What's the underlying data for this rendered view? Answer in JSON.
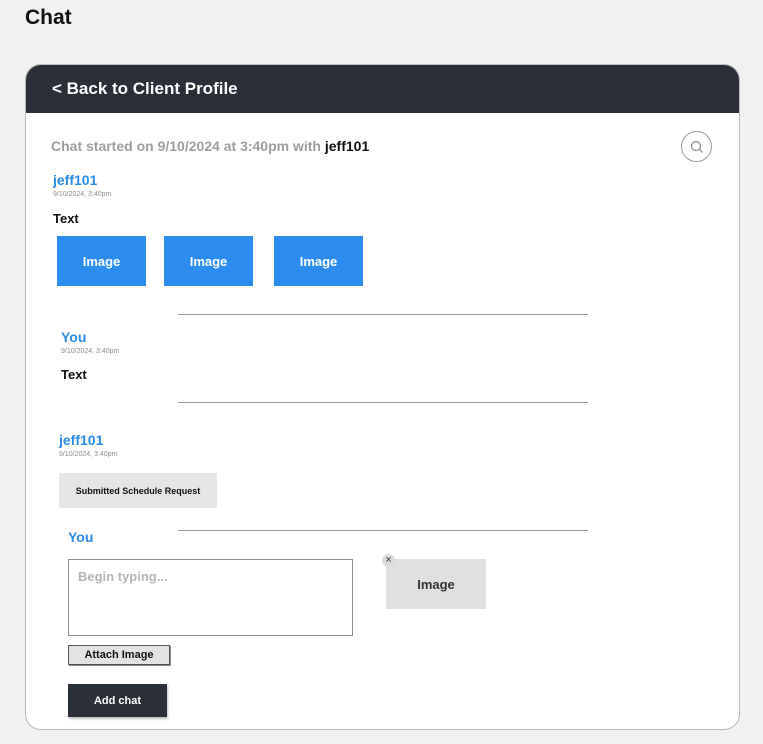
{
  "page": {
    "title": "Chat"
  },
  "header": {
    "back_label": "< Back to Client Profile"
  },
  "chat_info": {
    "started_prefix": "Chat started on 9/10/2024 at 3:40pm with",
    "started_user": "jeff101"
  },
  "search": {
    "icon": "search-icon"
  },
  "messages": [
    {
      "author": "jeff101",
      "timestamp": "9/10/2024, 3:40pm",
      "text": "Text",
      "images": [
        "Image",
        "Image",
        "Image"
      ]
    },
    {
      "author": "You",
      "timestamp": "9/10/2024, 3:40pm",
      "text": "Text"
    },
    {
      "author": "jeff101",
      "timestamp": "9/10/2024, 3:40pm",
      "attachment_label": "Submitted Schedule Request"
    }
  ],
  "composer": {
    "author": "You",
    "placeholder": "Begin typing...",
    "value": "",
    "attach_label": "Attach Image",
    "submit_label": "Add chat",
    "preview_label": "Image",
    "remove_symbol": "×"
  },
  "colors": {
    "accent": "#2d8cf0",
    "header": "#2b3038",
    "author": "#2b8ae6"
  }
}
